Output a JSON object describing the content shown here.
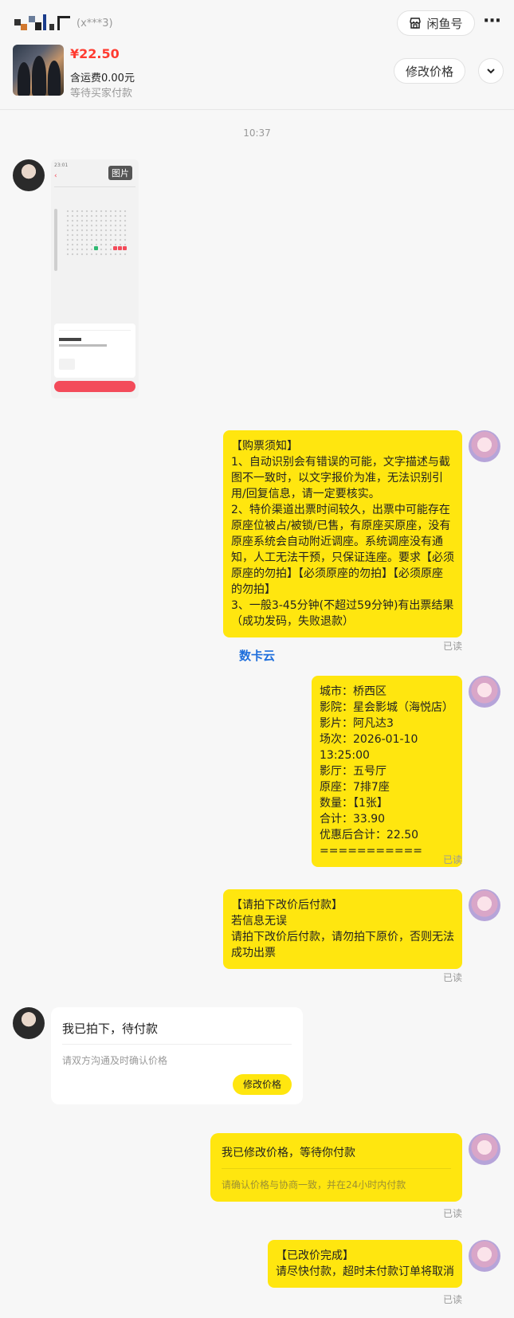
{
  "header": {
    "masked_username": "(x***3)",
    "xianyu_button": "闲鱼号",
    "more_icon": "more-dots-icon",
    "price": "¥22.50",
    "shipping": "含运费0.00元",
    "status": "等待买家付款",
    "modify_price_button": "修改价格"
  },
  "time": "10:37",
  "screenshot_badge": "图片",
  "messages": {
    "notice": {
      "lines": [
        "【购票须知】",
        "1、自动识别会有错误的可能，文字描述与截",
        "图不一致时，以文字报价为准，无法识别引",
        "用/回复信息，请一定要核实。",
        "2、特价渠道出票时间较久，出票中可能存在",
        "原座位被占/被锁/已售，有原座买原座，没有",
        "原座系统会自动附近调座。系统调座没有通",
        "知，人工无法干预，只保证连座。要求【必须",
        "原座的勿拍】【必须原座的勿拍】【必须原座",
        "的勿拍】",
        "3、一般3-45分钟(不超过59分钟)有出票结果",
        "（成功发码，失败退款）"
      ],
      "read": "已读"
    },
    "brand": "数卡云",
    "order": {
      "lines": [
        "城市：桥西区",
        "影院：星会影城（海悦店）",
        "影片：阿凡达3",
        "场次：2026-01-10 13:25:00",
        "影厅：五号厅",
        "原座：7排7座",
        "数量：【1张】",
        "合计：33.90",
        "优惠后合计：22.50",
        "==========="
      ],
      "read": "已读"
    },
    "pay_notice": {
      "lines": [
        "【请拍下改价后付款】",
        "若信息无误",
        "请拍下改价后付款，请勿拍下原价，否则无法",
        "成功出票"
      ],
      "read": "已读"
    },
    "buyer_card": {
      "title": "我已拍下，待付款",
      "hint": "请双方沟通及时确认价格",
      "button": "修改价格"
    },
    "seller_card": {
      "title": "我已修改价格，等待你付款",
      "hint": "请确认价格与协商一致，并在24小时内付款",
      "read": "已读"
    },
    "done": {
      "lines": [
        "【已改价完成】",
        "请尽快付款，超时未付款订单将取消"
      ],
      "read": "已读"
    }
  },
  "colors": {
    "bubble_yellow": "#ffe60f",
    "price_red": "#ff3b30",
    "brand_blue": "#1f6fdc"
  }
}
